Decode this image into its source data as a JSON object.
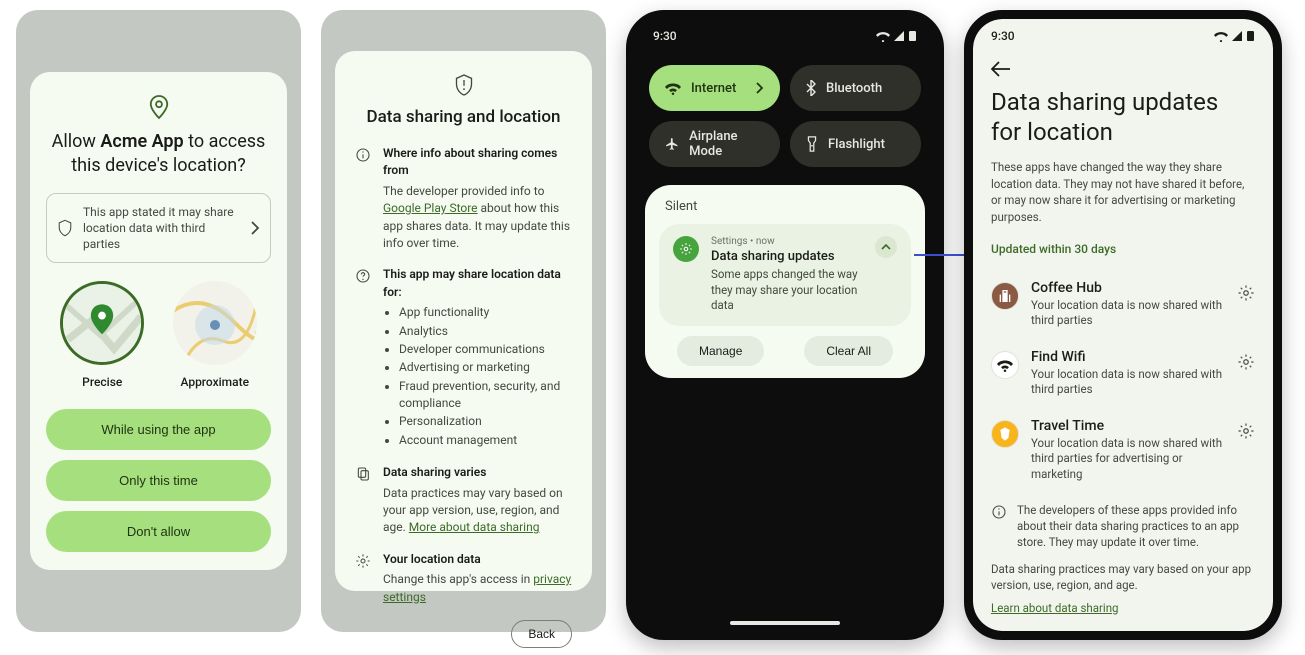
{
  "panel1": {
    "title_pre": "Allow ",
    "title_app": "Acme App",
    "title_post": " to access this device's location?",
    "info": "This app stated it may share location data with third parties",
    "precise": "Precise",
    "approx": "Approximate",
    "btn_while": "While using the app",
    "btn_once": "Only this time",
    "btn_deny": "Don't allow"
  },
  "panel2": {
    "title": "Data sharing and location",
    "s1_head": "Where info about sharing comes from",
    "s1_body_pre": "The developer provided info to ",
    "s1_link": "Google Play Store",
    "s1_body_post": " about how this app shares data. It may update this info over time.",
    "s2_head": "This app may share location data for:",
    "s2_items": [
      "App functionality",
      "Analytics",
      "Developer communications",
      "Advertising or marketing",
      "Fraud prevention, security, and compliance",
      "Personalization",
      "Account management"
    ],
    "s3_head": "Data sharing varies",
    "s3_body_pre": "Data practices may vary based on your app version, use, region, and age. ",
    "s3_link": "More about data sharing",
    "s4_head": "Your location data",
    "s4_body_pre": "Change this app's access in ",
    "s4_link": "privacy settings",
    "back": "Back"
  },
  "phone3": {
    "time": "9:30",
    "tiles": {
      "internet": "Internet",
      "bluetooth": "Bluetooth",
      "airplane": "Airplane Mode",
      "flashlight": "Flashlight"
    },
    "silent": "Silent",
    "notif_meta": "Settings  •  now",
    "notif_title": "Data sharing updates",
    "notif_sub": "Some apps changed the way they may share your location data",
    "manage": "Manage",
    "clear": "Clear All"
  },
  "phone4": {
    "time": "9:30",
    "h1a": "Data sharing updates",
    "h1b": "for location",
    "desc": "These apps have changed the way they share location data. They may not have shared it before, or may now share it for advertising or marketing purposes.",
    "updated": "Updated within 30 days",
    "apps": [
      {
        "name": "Coffee Hub",
        "sub": "Your location data is now shared with third parties",
        "bg": "#8a5a44",
        "fg": "#fff"
      },
      {
        "name": "Find Wifi",
        "sub": "Your location data is now shared with third parties",
        "bg": "#ffffff",
        "fg": "#1b1c18"
      },
      {
        "name": "Travel Time",
        "sub": "Your location data is now shared with third parties for advertising or marketing",
        "bg": "#f8b41d",
        "fg": "#fff"
      }
    ],
    "foot1": "The developers of these apps provided info about their data sharing practices to an app store. They may update it over time.",
    "foot2": "Data sharing practices may vary based on your app version, use, region, and age.",
    "learn": "Learn about data sharing"
  }
}
